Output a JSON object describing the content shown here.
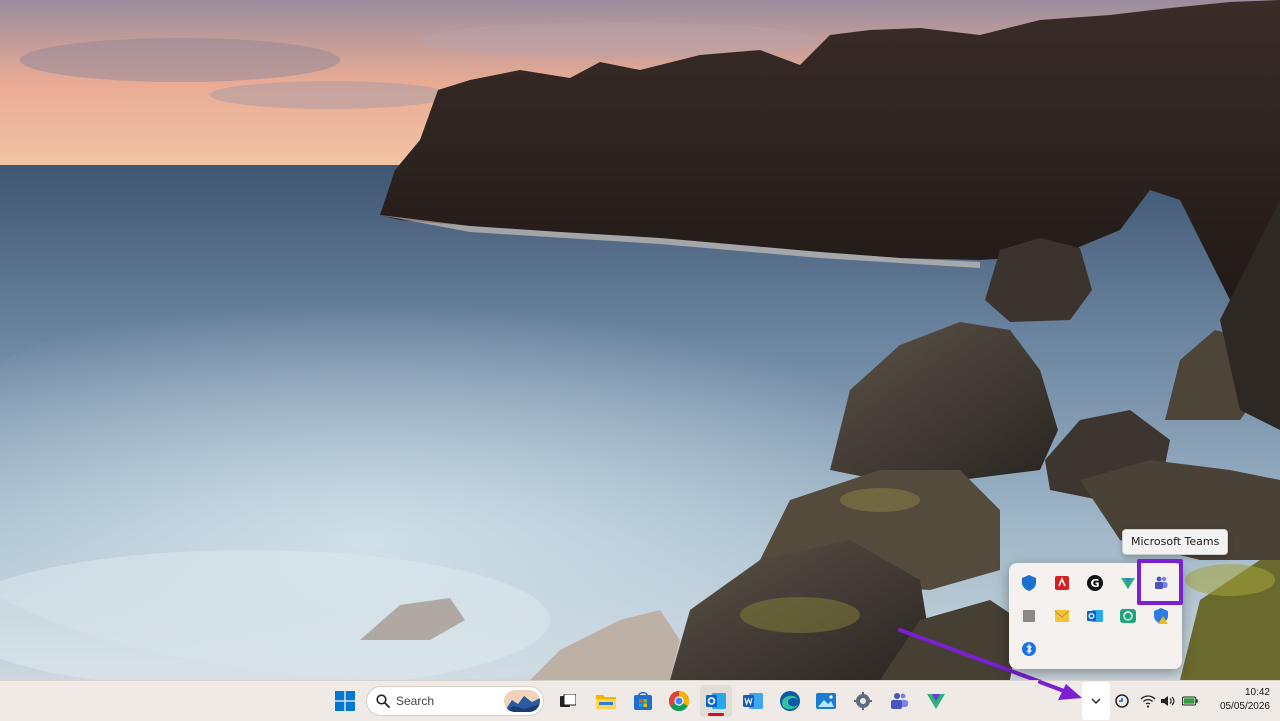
{
  "tooltip": {
    "text": "Microsoft Teams"
  },
  "taskbar": {
    "search_label": "Search",
    "pinned_apps": [
      "start-icon",
      "search-icon",
      "task-view-icon",
      "file-explorer-icon",
      "microsoft-store-icon",
      "chrome-icon",
      "outlook-icon",
      "word-icon",
      "edge-icon",
      "photos-icon",
      "settings-icon",
      "teams-icon",
      "vpn-icon"
    ]
  },
  "tray_flyout": {
    "icons": [
      "defender-icon",
      "adobe-icon",
      "grammarly-icon",
      "vpn-tray-icon",
      "teams-tray-icon",
      "app-square-icon",
      "mail-icon",
      "outlook-tray-icon",
      "sync-icon",
      "security-warning-icon",
      "bluetooth-icon"
    ]
  },
  "system_tray": {
    "icons": [
      "overflow-chevron-icon",
      "onedrive-sync-icon",
      "wifi-icon",
      "volume-icon",
      "battery-icon"
    ]
  },
  "clock": {
    "time": "10:42",
    "date": "05/05/2026"
  },
  "colors": {
    "highlight": "#7b1fd1",
    "taskbar": "#efeae6",
    "accent": "#0067c0"
  }
}
